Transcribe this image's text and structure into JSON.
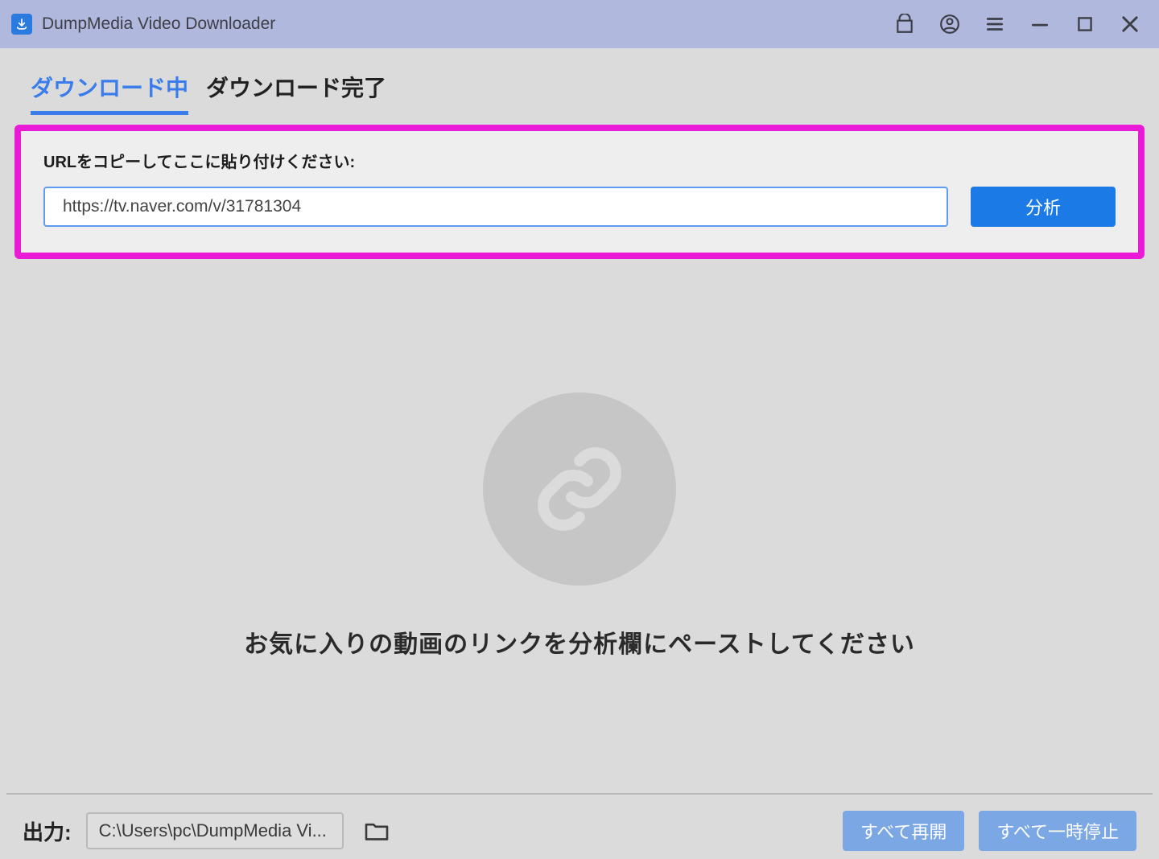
{
  "title_bar": {
    "app_title": "DumpMedia Video Downloader"
  },
  "tabs": {
    "downloading": "ダウンロード中",
    "completed": "ダウンロード完了"
  },
  "url_panel": {
    "label": "URLをコピーしてここに貼り付けください:",
    "value": "https://tv.naver.com/v/31781304",
    "analyze": "分析"
  },
  "empty": {
    "message": "お気に入りの動画のリンクを分析欄にペーストしてください"
  },
  "footer": {
    "output_label": "出力:",
    "output_path": "C:\\Users\\pc\\DumpMedia Vi...",
    "resume_all": "すべて再開",
    "pause_all": "すべて一時停止"
  }
}
